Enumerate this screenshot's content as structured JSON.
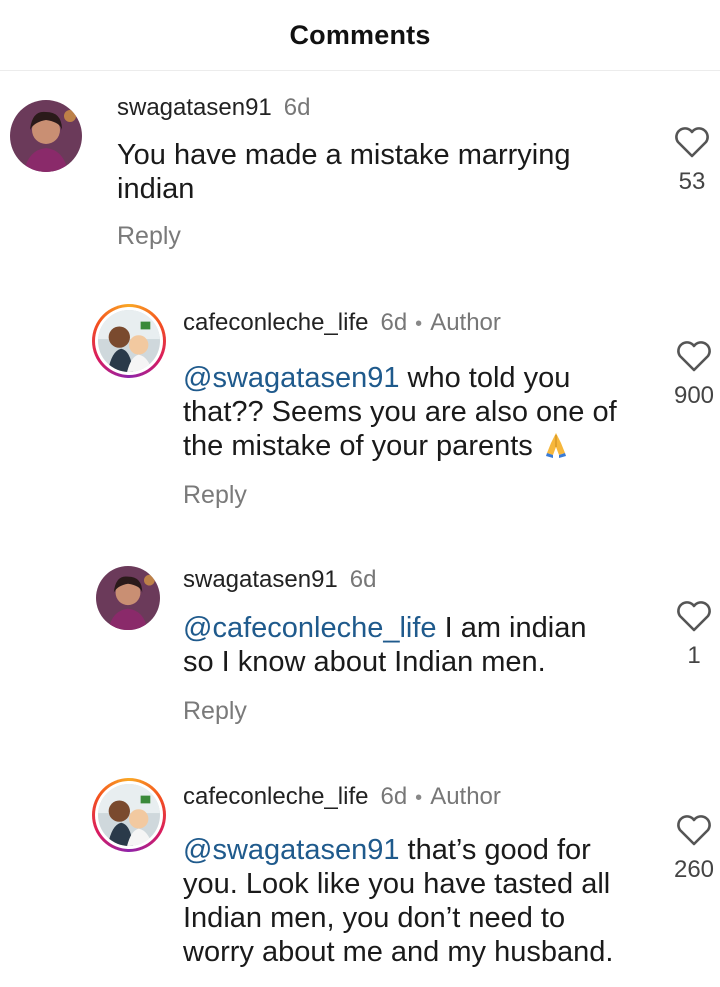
{
  "header": {
    "title": "Comments"
  },
  "comments": [
    {
      "username": "swagatasen91",
      "time": "6d",
      "text_line1": "You have made a mistake marrying",
      "text_line2": "indian",
      "reply_label": "Reply",
      "likes": "53"
    },
    {
      "username": "cafeconleche_life",
      "time": "6d",
      "dot": "•",
      "author_label": "Author",
      "mention": "@swagatasen91",
      "text_line1_rest": " who told you",
      "text_line2": "that?? Seems you are also one of",
      "text_line3": "the mistake of your parents",
      "reply_label": "Reply",
      "likes": "900",
      "emoji": "folded-hands-icon"
    },
    {
      "username": "swagatasen91",
      "time": "6d",
      "mention": "@cafeconleche_life",
      "text_line1_rest": " I am indian",
      "text_line2": "so I know about Indian men.",
      "reply_label": "Reply",
      "likes": "1"
    },
    {
      "username": "cafeconleche_life",
      "time": "6d",
      "dot": "•",
      "author_label": "Author",
      "mention": "@swagatasen91",
      "text_line1_rest": " that’s good for",
      "text_line2": "you. Look like you have tasted all",
      "text_line3": "Indian men, you don’t need to",
      "text_line4": "worry about me and my husband.",
      "likes": "260"
    }
  ],
  "colors": {
    "mention": "#1f5a8c",
    "muted": "#7a7a7a",
    "story_ring": "#d81b60"
  }
}
